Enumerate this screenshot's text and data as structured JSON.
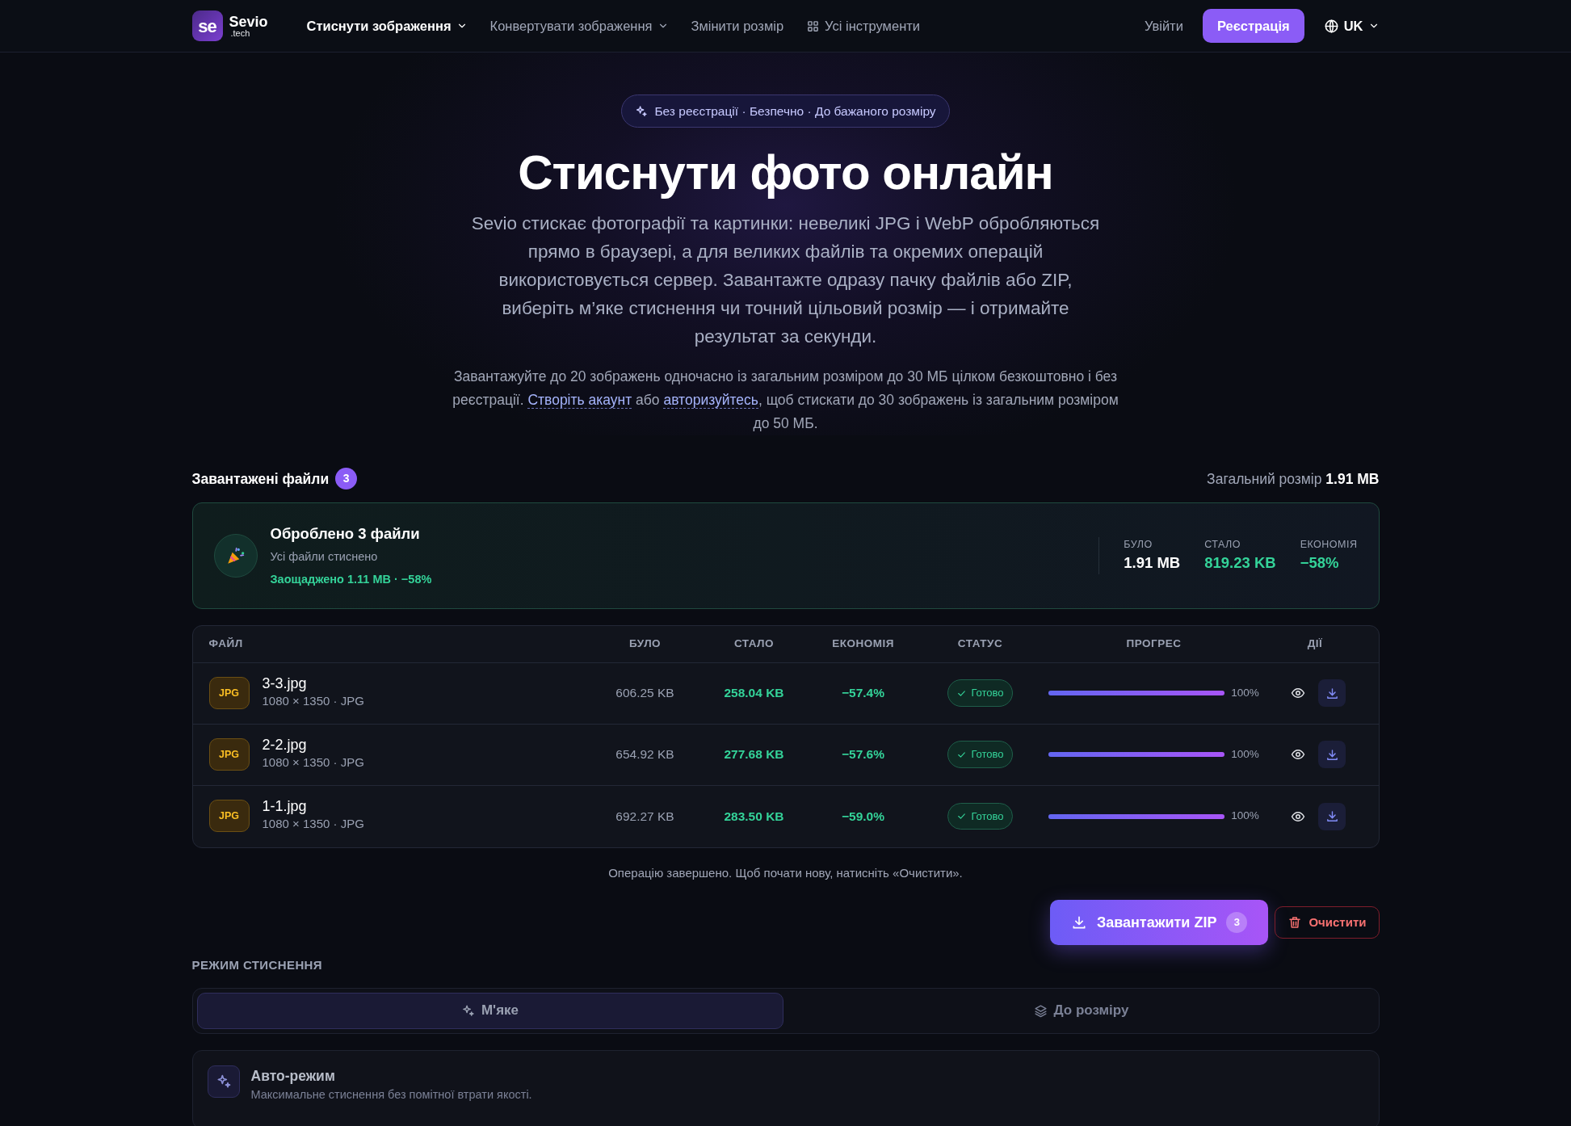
{
  "navbar": {
    "logo": {
      "mark": "se",
      "name": "Sevio",
      "sub": ".tech"
    },
    "items": [
      {
        "label": "Стиснути зображення",
        "kind": "dropdown",
        "selected": true
      },
      {
        "label": "Конвертувати зображення",
        "kind": "dropdown",
        "selected": false
      },
      {
        "label": "Змінити розмір",
        "kind": "link",
        "selected": false
      },
      {
        "label": "Усі інструменти",
        "kind": "tools",
        "selected": false
      }
    ],
    "login": "Увійти",
    "signup": "Реєстрація",
    "language": "UK"
  },
  "hero": {
    "badge": "Без реєстрації · Безпечно · До бажаного розміру",
    "title": "Стиснути фото онлайн",
    "lead": "Sevio стискає фотографії та картинки: невеликі JPG і WebP обробляються прямо в браузері, а для великих файлів та окремих операцій використовується сервер. Завантажте одразу пачку файлів або ZIP, виберіть м’яке стиснення чи точний цільовий розмір — і отримайте результат за секунди.",
    "note": [
      {
        "kind": "text",
        "text": "Завантажуйте до 20 зображень одночасно із загальним розміром до 30 МБ цілком безкоштовно і без реєстрації. "
      },
      {
        "kind": "link",
        "text": "Створіть акаунт"
      },
      {
        "kind": "text",
        "text": " або "
      },
      {
        "kind": "link",
        "text": "авторизуйтесь"
      },
      {
        "kind": "text",
        "text": ", щоб стискати до 30 зображень із загальним розміром до 50 МБ."
      }
    ]
  },
  "files": {
    "title": "Завантажені файли",
    "count": "3",
    "total_label": "Загальний розмір",
    "total": "1.91 MB"
  },
  "summary": {
    "title": "Оброблено 3 файли",
    "subtitle": "Усі файли стиснено",
    "saved": "Заощаджено 1.11 MB · −58%",
    "stats": [
      {
        "label": "БУЛО",
        "value": "1.91 MB",
        "highlight": false
      },
      {
        "label": "СТАЛО",
        "value": "819.23 KB",
        "highlight": true
      },
      {
        "label": "ЕКОНОМІЯ",
        "value": "−58%",
        "highlight": true
      }
    ]
  },
  "table": {
    "columns": [
      "ФАЙЛ",
      "БУЛО",
      "СТАЛО",
      "ЕКОНОМІЯ",
      "СТАТУС",
      "ПРОГРЕС",
      "ДІЇ"
    ],
    "rows": [
      {
        "type": "JPG",
        "name": "3-3.jpg",
        "meta": "1080 × 1350 · JPG",
        "before": "606.25 KB",
        "after": "258.04 KB",
        "saving": "−57.4%",
        "status": "Готово",
        "level": 1,
        "progress": "100%"
      },
      {
        "type": "JPG",
        "name": "2-2.jpg",
        "meta": "1080 × 1350 · JPG",
        "before": "654.92 KB",
        "after": "277.68 KB",
        "saving": "−57.6%",
        "status": "Готово",
        "level": 1,
        "progress": "100%"
      },
      {
        "type": "JPG",
        "name": "1-1.jpg",
        "meta": "1080 × 1350 · JPG",
        "before": "692.27 KB",
        "after": "283.50 KB",
        "saving": "−59.0%",
        "status": "Готово",
        "level": 1,
        "progress": "100%"
      }
    ]
  },
  "done_note": "Операцію завершено. Щоб почати нову, натисніть «Очистити».",
  "zip_button": {
    "label": "Завантажити ZIP",
    "count": "3"
  },
  "clear_button": "Очистити",
  "mode": {
    "label": "РЕЖИМ СТИСНЕННЯ",
    "tabs": [
      {
        "label": "М'яке",
        "kind": "soft",
        "selected": true
      },
      {
        "label": "До розміру",
        "kind": "size",
        "selected": false
      }
    ],
    "auto": {
      "title": "Авто-режим",
      "description": "Максимальне стиснення без помітної втрати якості."
    }
  }
}
